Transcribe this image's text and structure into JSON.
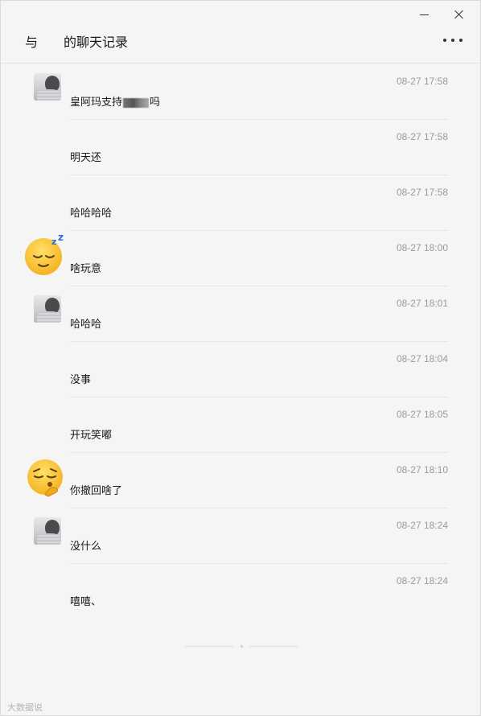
{
  "header": {
    "title_prefix": "与",
    "title_suffix": "的聊天记录",
    "more_icon": "more-dots-icon"
  },
  "window_controls": {
    "minimize_icon": "minimize-icon",
    "close_icon": "close-icon"
  },
  "messages": [
    {
      "sender": "self-avatar",
      "time": "08-27 17:58",
      "text_a": "皇阿玛支持",
      "text_b": "吗",
      "has_blur": true
    },
    {
      "sender": "",
      "time": "08-27 17:58",
      "text": "明天还"
    },
    {
      "sender": "",
      "time": "08-27 17:58",
      "text": "哈哈哈哈"
    },
    {
      "sender": "sleepy-emoji",
      "time": "08-27 18:00",
      "text": "啥玩意"
    },
    {
      "sender": "self-avatar",
      "time": "08-27 18:01",
      "text": "哈哈哈"
    },
    {
      "sender": "",
      "time": "08-27 18:04",
      "text": "没事"
    },
    {
      "sender": "",
      "time": "08-27 18:05",
      "text": "开玩笑嘟"
    },
    {
      "sender": "thinking-emoji",
      "time": "08-27 18:10",
      "text": "你撤回啥了"
    },
    {
      "sender": "self-avatar",
      "time": "08-27 18:24",
      "text": "没什么"
    },
    {
      "sender": "",
      "time": "08-27 18:24",
      "text": "嘻嘻、"
    }
  ],
  "watermark": "大数据说"
}
